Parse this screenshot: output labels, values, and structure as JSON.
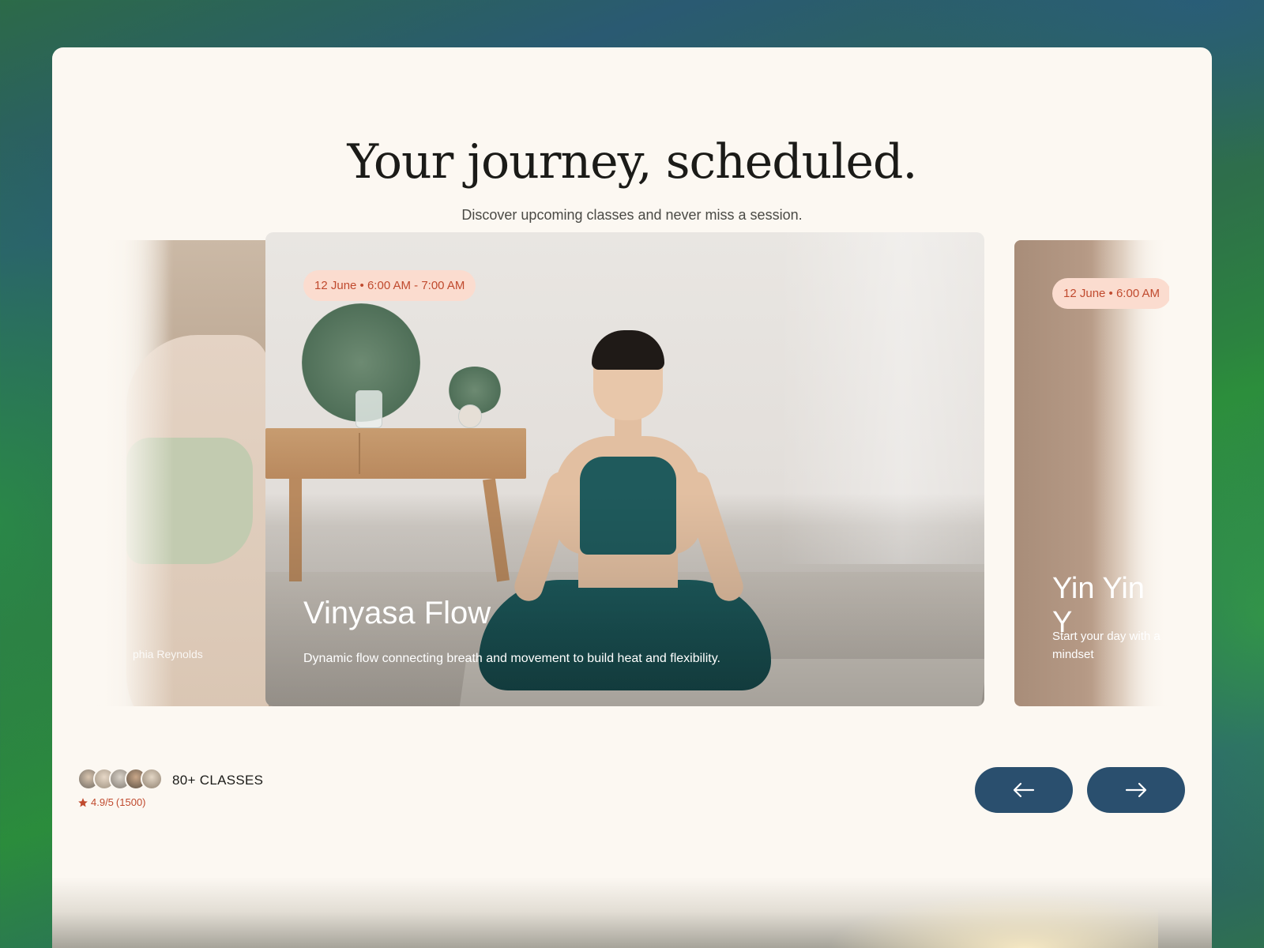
{
  "header": {
    "title": "Your journey, scheduled.",
    "subtitle": "Discover upcoming classes and never miss a session."
  },
  "carousel": {
    "prev_card": {
      "instructor": "phia Reynolds"
    },
    "main_card": {
      "date": "12 June • 6:00 AM - 7:00 AM",
      "title": "Vinyasa Flow",
      "description": "Dynamic flow connecting breath and movement to build heat and flexibility."
    },
    "next_card": {
      "date": "12 June • 6:00 AM",
      "title": "Yin Yin Y",
      "description": "Start your day with a",
      "description_2": "mindset"
    }
  },
  "stats": {
    "classes_label": "80+ CLASSES",
    "rating": "4.9/5",
    "rating_count": "(1500)"
  },
  "colors": {
    "accent": "#c04a2e",
    "pill_bg": "#fbdccf",
    "nav_button": "#2a4f6e",
    "panel": "#fcf8f2"
  },
  "icons": {
    "prev": "arrow-left-icon",
    "next": "arrow-right-icon",
    "rating": "star-icon"
  }
}
